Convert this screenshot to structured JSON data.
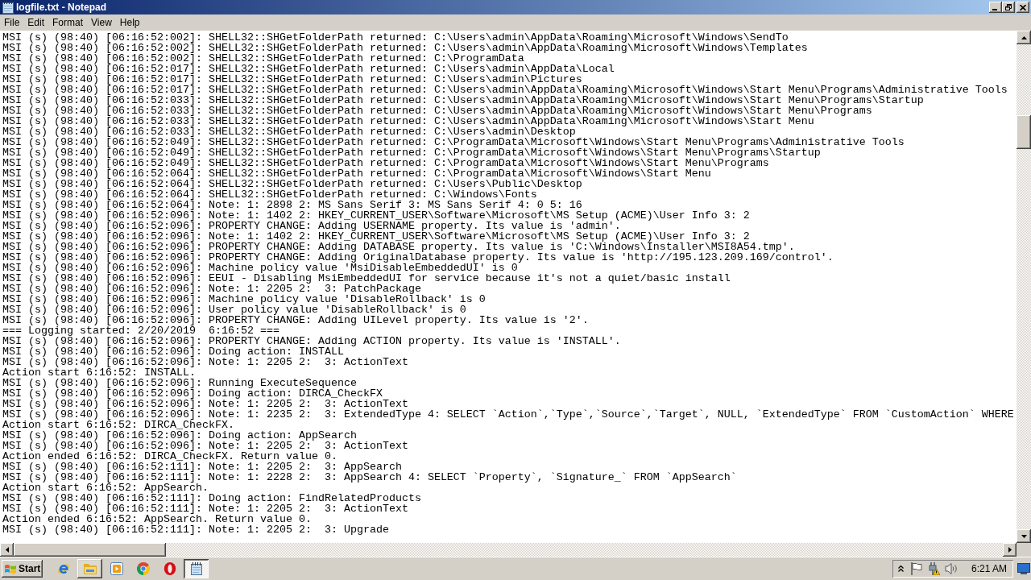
{
  "window": {
    "title": "logfile.txt - Notepad"
  },
  "menu": [
    "File",
    "Edit",
    "Format",
    "View",
    "Help"
  ],
  "document": {
    "lines": [
      "MSI (s) (98:40) [06:16:52:002]: SHELL32::SHGetFolderPath returned: C:\\Users\\admin\\AppData\\Roaming\\Microsoft\\Windows\\SendTo",
      "MSI (s) (98:40) [06:16:52:002]: SHELL32::SHGetFolderPath returned: C:\\Users\\admin\\AppData\\Roaming\\Microsoft\\Windows\\Templates",
      "MSI (s) (98:40) [06:16:52:002]: SHELL32::SHGetFolderPath returned: C:\\ProgramData",
      "MSI (s) (98:40) [06:16:52:017]: SHELL32::SHGetFolderPath returned: C:\\Users\\admin\\AppData\\Local",
      "MSI (s) (98:40) [06:16:52:017]: SHELL32::SHGetFolderPath returned: C:\\Users\\admin\\Pictures",
      "MSI (s) (98:40) [06:16:52:017]: SHELL32::SHGetFolderPath returned: C:\\Users\\admin\\AppData\\Roaming\\Microsoft\\Windows\\Start Menu\\Programs\\Administrative Tools",
      "MSI (s) (98:40) [06:16:52:033]: SHELL32::SHGetFolderPath returned: C:\\Users\\admin\\AppData\\Roaming\\Microsoft\\Windows\\Start Menu\\Programs\\Startup",
      "MSI (s) (98:40) [06:16:52:033]: SHELL32::SHGetFolderPath returned: C:\\Users\\admin\\AppData\\Roaming\\Microsoft\\Windows\\Start Menu\\Programs",
      "MSI (s) (98:40) [06:16:52:033]: SHELL32::SHGetFolderPath returned: C:\\Users\\admin\\AppData\\Roaming\\Microsoft\\Windows\\Start Menu",
      "MSI (s) (98:40) [06:16:52:033]: SHELL32::SHGetFolderPath returned: C:\\Users\\admin\\Desktop",
      "MSI (s) (98:40) [06:16:52:049]: SHELL32::SHGetFolderPath returned: C:\\ProgramData\\Microsoft\\Windows\\Start Menu\\Programs\\Administrative Tools",
      "MSI (s) (98:40) [06:16:52:049]: SHELL32::SHGetFolderPath returned: C:\\ProgramData\\Microsoft\\Windows\\Start Menu\\Programs\\Startup",
      "MSI (s) (98:40) [06:16:52:049]: SHELL32::SHGetFolderPath returned: C:\\ProgramData\\Microsoft\\Windows\\Start Menu\\Programs",
      "MSI (s) (98:40) [06:16:52:064]: SHELL32::SHGetFolderPath returned: C:\\ProgramData\\Microsoft\\Windows\\Start Menu",
      "MSI (s) (98:40) [06:16:52:064]: SHELL32::SHGetFolderPath returned: C:\\Users\\Public\\Desktop",
      "MSI (s) (98:40) [06:16:52:064]: SHELL32::SHGetFolderPath returned: C:\\Windows\\Fonts",
      "MSI (s) (98:40) [06:16:52:064]: Note: 1: 2898 2: MS Sans Serif 3: MS Sans Serif 4: 0 5: 16",
      "MSI (s) (98:40) [06:16:52:096]: Note: 1: 1402 2: HKEY_CURRENT_USER\\Software\\Microsoft\\MS Setup (ACME)\\User Info 3: 2",
      "MSI (s) (98:40) [06:16:52:096]: PROPERTY CHANGE: Adding USERNAME property. Its value is 'admin'.",
      "MSI (s) (98:40) [06:16:52:096]: Note: 1: 1402 2: HKEY_CURRENT_USER\\Software\\Microsoft\\MS Setup (ACME)\\User Info 3: 2",
      "MSI (s) (98:40) [06:16:52:096]: PROPERTY CHANGE: Adding DATABASE property. Its value is 'C:\\Windows\\Installer\\MSI8A54.tmp'.",
      "MSI (s) (98:40) [06:16:52:096]: PROPERTY CHANGE: Adding OriginalDatabase property. Its value is 'http://195.123.209.169/control'.",
      "MSI (s) (98:40) [06:16:52:096]: Machine policy value 'MsiDisableEmbeddedUI' is 0",
      "MSI (s) (98:40) [06:16:52:096]: EEUI - Disabling MsiEmbeddedUI for service because it's not a quiet/basic install",
      "MSI (s) (98:40) [06:16:52:096]: Note: 1: 2205 2:  3: PatchPackage",
      "MSI (s) (98:40) [06:16:52:096]: Machine policy value 'DisableRollback' is 0",
      "MSI (s) (98:40) [06:16:52:096]: User policy value 'DisableRollback' is 0",
      "MSI (s) (98:40) [06:16:52:096]: PROPERTY CHANGE: Adding UILevel property. Its value is '2'.",
      "=== Logging started: 2/20/2019  6:16:52 ===",
      "MSI (s) (98:40) [06:16:52:096]: PROPERTY CHANGE: Adding ACTION property. Its value is 'INSTALL'.",
      "MSI (s) (98:40) [06:16:52:096]: Doing action: INSTALL",
      "MSI (s) (98:40) [06:16:52:096]: Note: 1: 2205 2:  3: ActionText",
      "Action start 6:16:52: INSTALL.",
      "MSI (s) (98:40) [06:16:52:096]: Running ExecuteSequence",
      "MSI (s) (98:40) [06:16:52:096]: Doing action: DIRCA_CheckFX",
      "MSI (s) (98:40) [06:16:52:096]: Note: 1: 2205 2:  3: ActionText",
      "MSI (s) (98:40) [06:16:52:096]: Note: 1: 2235 2:  3: ExtendedType 4: SELECT `Action`,`Type`,`Source`,`Target`, NULL, `ExtendedType` FROM `CustomAction` WHERE",
      "Action start 6:16:52: DIRCA_CheckFX.",
      "MSI (s) (98:40) [06:16:52:096]: Doing action: AppSearch",
      "MSI (s) (98:40) [06:16:52:096]: Note: 1: 2205 2:  3: ActionText",
      "Action ended 6:16:52: DIRCA_CheckFX. Return value 0.",
      "MSI (s) (98:40) [06:16:52:111]: Note: 1: 2205 2:  3: AppSearch",
      "MSI (s) (98:40) [06:16:52:111]: Note: 1: 2228 2:  3: AppSearch 4: SELECT `Property`, `Signature_` FROM `AppSearch`",
      "Action start 6:16:52: AppSearch.",
      "MSI (s) (98:40) [06:16:52:111]: Doing action: FindRelatedProducts",
      "MSI (s) (98:40) [06:16:52:111]: Note: 1: 2205 2:  3: ActionText",
      "Action ended 6:16:52: AppSearch. Return value 0.",
      "MSI (s) (98:40) [06:16:52:111]: Note: 1: 2205 2:  3: Upgrade"
    ]
  },
  "taskbar": {
    "start": "Start",
    "apps": [
      {
        "kind": "ie",
        "selected": false,
        "hovered": false
      },
      {
        "kind": "explorer",
        "selected": false,
        "hovered": true
      },
      {
        "kind": "player",
        "selected": false,
        "hovered": false
      },
      {
        "kind": "chrome",
        "selected": false,
        "hovered": false
      },
      {
        "kind": "opera",
        "selected": false,
        "hovered": false
      },
      {
        "kind": "notepad",
        "selected": true,
        "hovered": false
      }
    ],
    "clock": "6:21 AM"
  }
}
